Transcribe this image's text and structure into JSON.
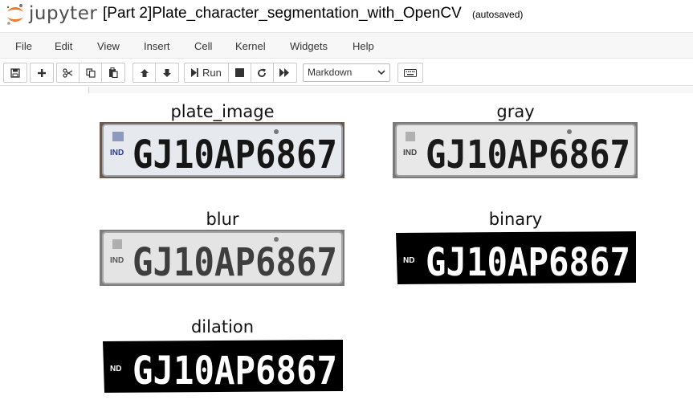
{
  "header": {
    "logo_text": "jupyter",
    "notebook_title": "[Part 2]Plate_character_segmentation_with_OpenCV",
    "save_status": "(autosaved)"
  },
  "menu": [
    "File",
    "Edit",
    "View",
    "Insert",
    "Cell",
    "Kernel",
    "Widgets",
    "Help"
  ],
  "toolbar": {
    "run_label": "Run",
    "cell_type": "Markdown",
    "cell_type_options": [
      "Markdown"
    ]
  },
  "output": {
    "plate_text": "GJ10AP6867",
    "ind_label": "IND",
    "panels": [
      {
        "title": "plate_image",
        "style": "color"
      },
      {
        "title": "gray",
        "style": "gray"
      },
      {
        "title": "blur",
        "style": "blur"
      },
      {
        "title": "binary",
        "style": "binary"
      },
      {
        "title": "dilation",
        "style": "dilation"
      }
    ]
  },
  "colors": {
    "jupyter_orange": "#f37726",
    "menubar_bg": "#f7f7f7",
    "plate_bg": "#e9ecef",
    "plate_dark": "#6b5a50"
  }
}
